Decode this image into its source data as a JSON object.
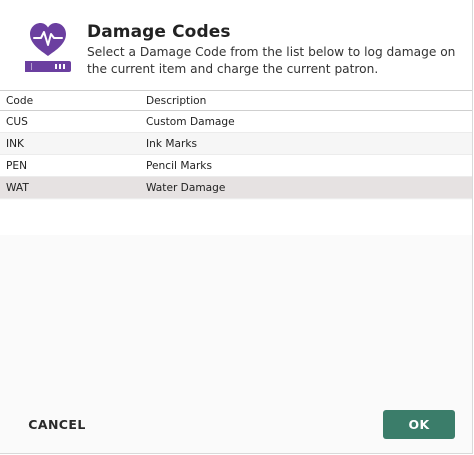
{
  "dialog": {
    "title": "Damage Codes",
    "subtitle": "Select a Damage Code from the list below to log damage on the current item and charge the current patron.",
    "icon": "heart-monitor-book-icon"
  },
  "table": {
    "columns": {
      "code": "Code",
      "description": "Description"
    },
    "rows": [
      {
        "code": "CUS",
        "description": "Custom Damage"
      },
      {
        "code": "INK",
        "description": "Ink Marks"
      },
      {
        "code": "PEN",
        "description": "Pencil Marks"
      },
      {
        "code": "WAT",
        "description": "Water Damage"
      }
    ],
    "selected_code": "WAT"
  },
  "buttons": {
    "cancel": "CANCEL",
    "ok": "OK"
  },
  "colors": {
    "accent": "#6b3fa0",
    "ok_button": "#3b7d6a",
    "selected_row": "#e6e2e2"
  }
}
